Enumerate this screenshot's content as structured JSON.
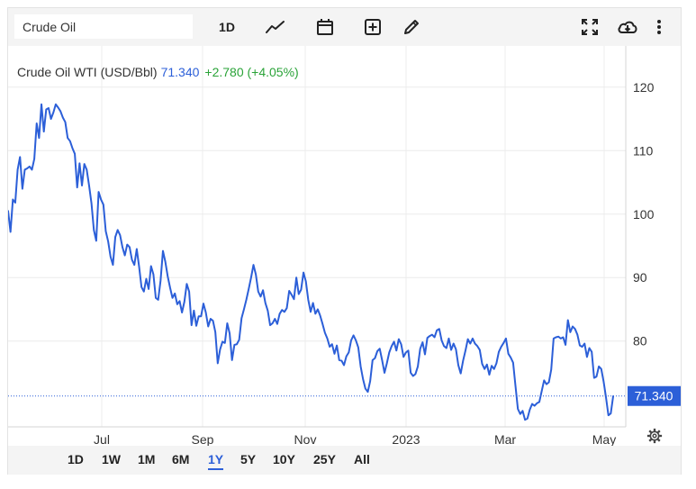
{
  "toolbar": {
    "symbol_value": "Crude Oil",
    "interval_label": "1D"
  },
  "legend": {
    "name": "Crude Oil WTI (USD/Bbl)",
    "price": "71.340",
    "change": "+2.780 (+4.05%)"
  },
  "range_buttons": [
    "1D",
    "1W",
    "1M",
    "6M",
    "1Y",
    "5Y",
    "10Y",
    "25Y",
    "All"
  ],
  "active_range": "1Y",
  "colors": {
    "line": "#2c5fd8",
    "up": "#2aa338",
    "grid": "#ececec"
  },
  "chart_data": {
    "type": "line",
    "title": "",
    "xlabel": "",
    "ylabel": "",
    "x_ticks": [
      "Jul",
      "Sep",
      "Nov",
      "2023",
      "Mar",
      "May"
    ],
    "y_ticks": [
      80,
      90,
      100,
      110,
      120
    ],
    "ylim": [
      63.5,
      126.5
    ],
    "last_value": 71.34,
    "y_axis": "right",
    "grid": true,
    "series": [
      {
        "values": [
          100.5,
          97.2,
          102.3,
          101.8,
          107.0,
          109.0,
          104.0,
          107.0,
          107.2,
          107.5,
          107.0,
          108.7,
          114.3,
          112.0,
          117.3,
          113.0,
          116.5,
          116.7,
          115.0,
          116.0,
          117.3,
          116.8,
          116.2,
          115.2,
          114.5,
          112.0,
          111.5,
          110.4,
          109.5,
          104.2,
          108.0,
          104.5,
          107.9,
          107.0,
          104.5,
          101.7,
          97.5,
          95.8,
          103.5,
          102.3,
          101.5,
          97.3,
          95.7,
          93.3,
          92.0,
          96.4,
          97.5,
          96.7,
          94.8,
          93.5,
          95.2,
          94.8,
          92.8,
          92.0,
          94.5,
          91.7,
          88.5,
          87.8,
          89.8,
          88.2,
          91.8,
          90.5,
          86.8,
          86.5,
          89.5,
          94.2,
          92.5,
          90.2,
          88.4,
          86.8,
          87.5,
          85.8,
          86.3,
          84.5,
          86.2,
          89.0,
          87.8,
          82.5,
          84.8,
          82.4,
          83.9,
          83.9,
          85.9,
          84.5,
          82.3,
          83.5,
          83.2,
          81.4,
          76.5,
          78.7,
          79.9,
          79.7,
          82.8,
          81.2,
          77.0,
          79.4,
          79.5,
          80.2,
          83.6,
          85.0,
          86.5,
          88.2,
          90.0,
          92.0,
          90.5,
          87.8,
          87.0,
          88.0,
          86.0,
          84.8,
          82.5,
          82.8,
          83.5,
          82.7,
          84.3,
          84.9,
          84.6,
          85.2,
          87.9,
          87.3,
          86.6,
          90.0,
          87.4,
          88.1,
          90.8,
          89.4,
          86.5,
          84.6,
          86.0,
          84.3,
          85.0,
          84.0,
          82.7,
          81.3,
          80.4,
          79.1,
          79.5,
          78.0,
          79.3,
          77.0,
          76.9,
          76.2,
          77.6,
          78.2,
          80.1,
          80.9,
          80.1,
          79.0,
          76.0,
          74.0,
          72.5,
          72.0,
          73.7,
          77.0,
          77.3,
          78.4,
          78.8,
          77.0,
          75.0,
          76.5,
          78.2,
          79.2,
          79.9,
          78.5,
          80.3,
          79.5,
          77.5,
          78.2,
          78.5,
          75.0,
          74.5,
          74.8,
          76.0,
          78.8,
          79.8,
          77.9,
          80.5,
          80.8,
          81.0,
          80.6,
          81.7,
          81.9,
          80.1,
          79.2,
          78.9,
          80.4,
          78.6,
          79.6,
          78.7,
          76.2,
          74.9,
          76.9,
          78.5,
          80.3,
          79.6,
          80.4,
          79.6,
          79.2,
          78.6,
          76.4,
          75.6,
          76.3,
          74.7,
          76.1,
          75.6,
          76.5,
          78.3,
          79.1,
          79.7,
          80.4,
          78.0,
          77.4,
          76.6,
          72.9,
          69.3,
          68.5,
          69.0,
          67.6,
          67.8,
          69.2,
          70.1,
          69.8,
          70.2,
          70.4,
          72.1,
          73.8,
          73.2,
          73.5,
          75.5,
          80.4,
          80.6,
          80.7,
          80.4,
          80.6,
          79.4,
          83.3,
          81.4,
          82.3,
          81.9,
          81.0,
          79.3,
          79.1,
          79.6,
          77.5,
          78.9,
          78.3,
          74.2,
          74.4,
          76.0,
          75.6,
          73.6,
          71.1,
          68.3,
          68.6,
          71.3
        ]
      }
    ]
  }
}
